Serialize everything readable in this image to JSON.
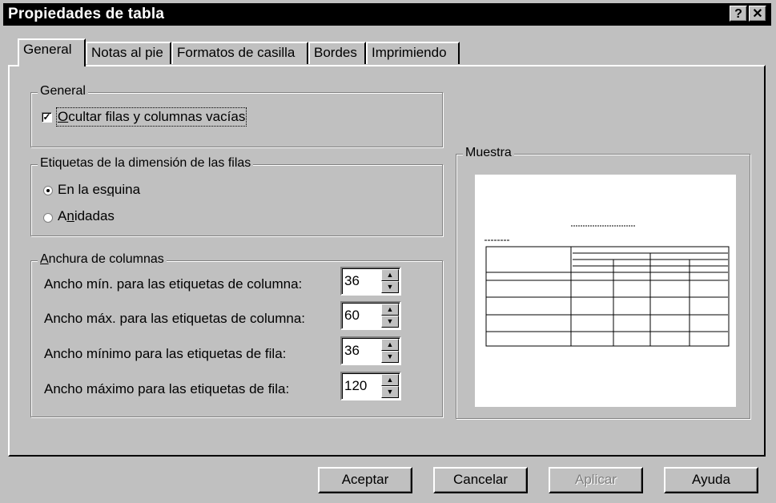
{
  "window": {
    "title": "Propiedades de tabla",
    "help_btn": "?",
    "close_btn": "✕"
  },
  "tabs": [
    {
      "label": "General"
    },
    {
      "label": "Notas al pie"
    },
    {
      "label": "Formatos de casilla"
    },
    {
      "label": "Bordes"
    },
    {
      "label": "Imprimiendo"
    }
  ],
  "general_group": {
    "legend": "General",
    "hide_label_mn": "O",
    "hide_label_rest": "cultar filas y columnas vacías",
    "hide_checked": "✓"
  },
  "row_dim_group": {
    "legend": "Etiquetas de la dimensión de las filas",
    "corner_pre": "En la es",
    "corner_mn": "q",
    "corner_post": "uina",
    "nested_pre": "A",
    "nested_mn": "n",
    "nested_post": "idadas"
  },
  "width_group": {
    "legend_mn": "A",
    "legend_rest": "nchura de columnas",
    "rows": [
      {
        "label": "Ancho mín. para las etiquetas de columna:",
        "value": "36"
      },
      {
        "label": "Ancho máx. para las etiquetas de columna:",
        "value": "60"
      },
      {
        "label": "Ancho mínimo para las etiquetas de fila:",
        "value": "36"
      },
      {
        "label": "Ancho máximo para las etiquetas de fila:",
        "value": "120"
      }
    ]
  },
  "sample_group": {
    "legend": "Muestra"
  },
  "buttons": {
    "ok": "Aceptar",
    "cancel": "Cancelar",
    "apply": "Aplicar",
    "help": "Ayuda"
  }
}
